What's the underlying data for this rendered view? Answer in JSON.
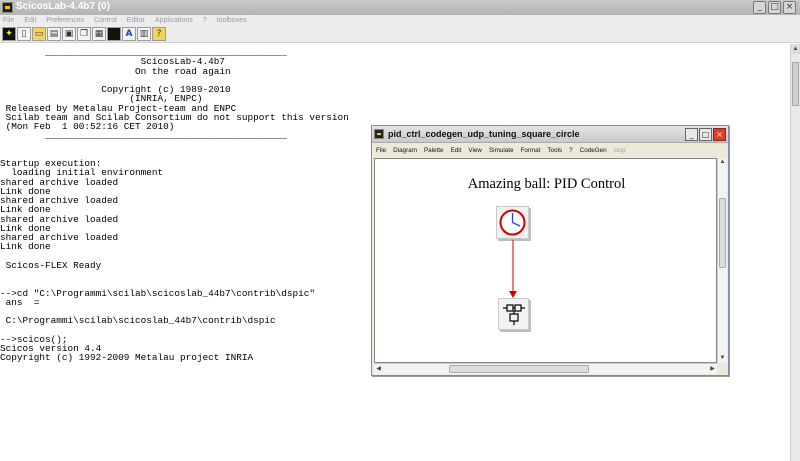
{
  "main_window": {
    "title": "ScicosLab-4.4b7 (0)",
    "menu": [
      "File",
      "Edit",
      "Preferences",
      "Control",
      "Editor",
      "Applications",
      "?",
      "toolboxes"
    ],
    "toolbar_icons": [
      "scicos-icon",
      "new-file-icon",
      "open-icon",
      "load-icon",
      "save-icon",
      "copy-icon",
      "paste-icon",
      "console-icon",
      "font-icon",
      "print-icon",
      "help-icon"
    ],
    "console_lines": [
      "        ___________________________________________",
      "                         ScicosLab-4.4b7",
      "                        On the road again",
      "",
      "                  Copyright (c) 1989-2010",
      "                       (INRIA, ENPC)",
      " Released by Metalau Project-team and ENPC",
      " Scilab team and Scilab Consortium do not support this version",
      " (Mon Feb  1 00:52:16 CET 2010)",
      "        ___________________________________________",
      "",
      "",
      "Startup execution:",
      "  loading initial environment",
      "shared archive loaded",
      "Link done",
      "shared archive loaded",
      "Link done",
      "shared archive loaded",
      "Link done",
      "shared archive loaded",
      "Link done",
      "",
      " Scicos-FLEX Ready",
      "",
      "",
      "-->cd \"C:\\Programmi\\scilab\\scicoslab_44b7\\contrib\\dspic\"",
      " ans  =",
      "",
      " C:\\Programmi\\scilab\\scicoslab_44b7\\contrib\\dspic",
      "",
      "-->scicos();",
      "Scicos version 4.4",
      "Copyright (c) 1992-2009 Metalau project INRIA"
    ]
  },
  "diagram_window": {
    "title": "pid_ctrl_codegen_udp_tuning_square_circle",
    "menu": [
      "File",
      "Diagram",
      "Palette",
      "Edit",
      "View",
      "Simulate",
      "Format",
      "Tools",
      "?",
      "CodeGen"
    ],
    "menu_disabled": "stop",
    "diagram_title": "Amazing ball: PID Control",
    "blocks": [
      {
        "name": "clock-block",
        "icon": "clock-icon"
      },
      {
        "name": "superblock",
        "icon": "superblock-icon"
      }
    ],
    "link_color": "#d00000"
  },
  "colors": {
    "accent_red": "#d00000",
    "clock_blue": "#2b3fbf"
  }
}
